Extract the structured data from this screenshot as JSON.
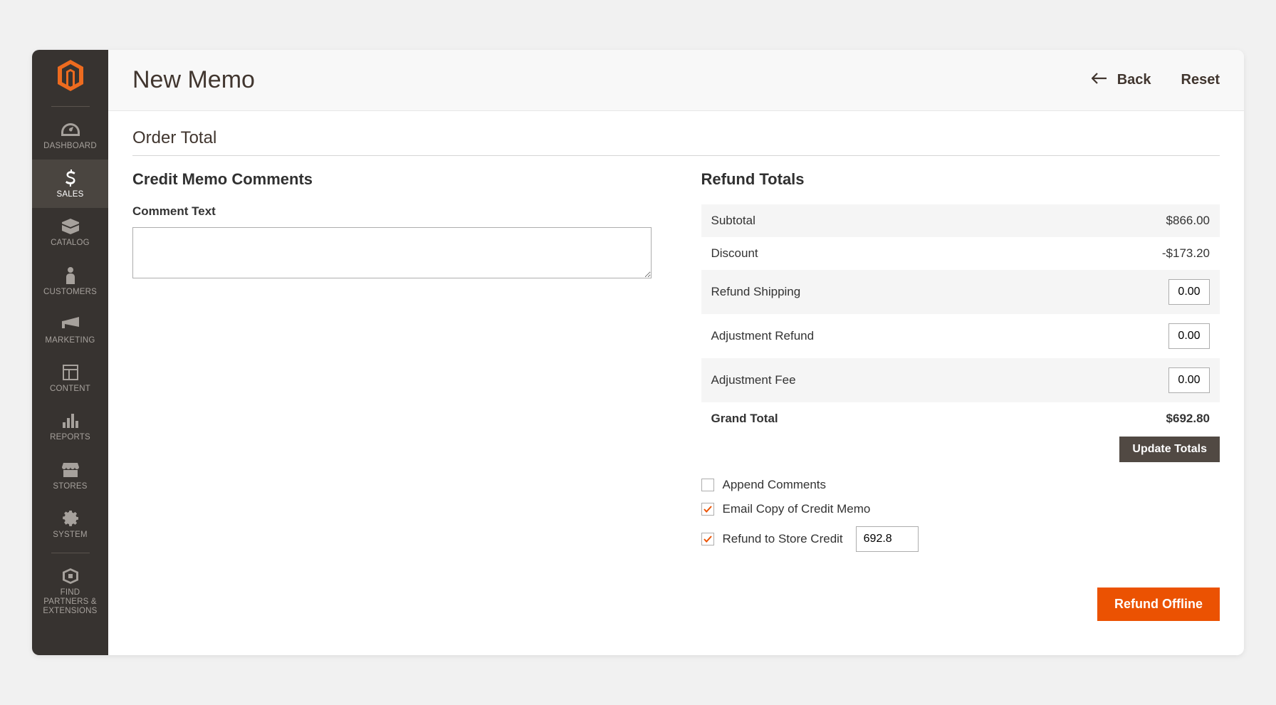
{
  "header": {
    "title": "New Memo",
    "back_label": "Back",
    "reset_label": "Reset"
  },
  "sidebar": {
    "items": [
      {
        "label": "DASHBOARD"
      },
      {
        "label": "SALES"
      },
      {
        "label": "CATALOG"
      },
      {
        "label": "CUSTOMERS"
      },
      {
        "label": "MARKETING"
      },
      {
        "label": "CONTENT"
      },
      {
        "label": "REPORTS"
      },
      {
        "label": "STORES"
      },
      {
        "label": "SYSTEM"
      },
      {
        "label": "FIND PARTNERS & EXTENSIONS"
      }
    ]
  },
  "section": {
    "order_total": "Order Total",
    "comments_heading": "Credit Memo Comments",
    "comment_label": "Comment Text",
    "comment_value": "",
    "refund_heading": "Refund Totals"
  },
  "totals": {
    "subtotal_label": "Subtotal",
    "subtotal_value": "$866.00",
    "discount_label": "Discount",
    "discount_value": "-$173.20",
    "refund_shipping_label": "Refund Shipping",
    "refund_shipping_value": "0.00",
    "adjustment_refund_label": "Adjustment Refund",
    "adjustment_refund_value": "0.00",
    "adjustment_fee_label": "Adjustment Fee",
    "adjustment_fee_value": "0.00",
    "grand_total_label": "Grand Total",
    "grand_total_value": "$692.80",
    "update_button": "Update Totals"
  },
  "options": {
    "append_comments_label": "Append Comments",
    "email_copy_label": "Email Copy of Credit Memo",
    "refund_store_credit_label": "Refund to Store Credit",
    "refund_store_credit_value": "692.8"
  },
  "actions": {
    "refund_offline": "Refund Offline"
  }
}
